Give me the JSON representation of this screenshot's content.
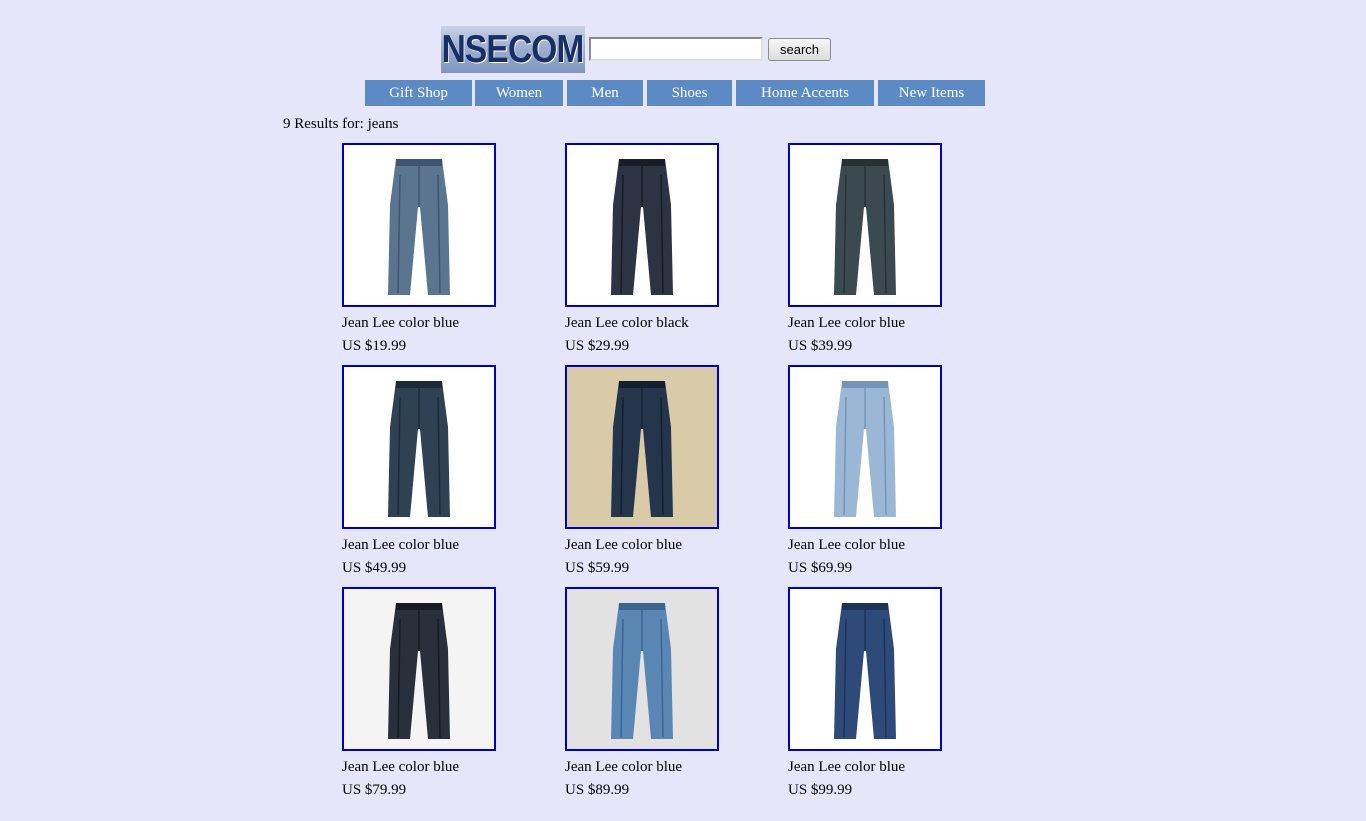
{
  "brand": {
    "logo_text": "NSECOM"
  },
  "search": {
    "value": "",
    "placeholder": "",
    "button_label": "search"
  },
  "nav": {
    "items": [
      {
        "label": "Gift Shop"
      },
      {
        "label": "Women"
      },
      {
        "label": "Men"
      },
      {
        "label": "Shoes"
      },
      {
        "label": "Home Accents"
      },
      {
        "label": "New Items"
      }
    ]
  },
  "results": {
    "heading": "9 Results for: jeans",
    "products": [
      {
        "name": "Jean Lee color blue",
        "price": "US $19.99",
        "image": "blue-jeans-back-icon",
        "bg": "#ffffff",
        "color": "#5b7590",
        "shade": "#3d5570"
      },
      {
        "name": "Jean Lee color black",
        "price": "US $29.99",
        "image": "black-jeans-icon",
        "bg": "#ffffff",
        "color": "#2c3444",
        "shade": "#171c26"
      },
      {
        "name": "Jean Lee color blue",
        "price": "US $39.99",
        "image": "dark-jeans-model-icon",
        "bg": "#ffffff",
        "color": "#3b4a50",
        "shade": "#263135"
      },
      {
        "name": "Jean Lee color blue",
        "price": "US $49.99",
        "image": "dark-jeans-open-fly-icon",
        "bg": "#ffffff",
        "color": "#2f4253",
        "shade": "#1c2a36"
      },
      {
        "name": "Jean Lee color blue",
        "price": "US $59.99",
        "image": "jeans-on-canvas-icon",
        "bg": "#d9cba8",
        "color": "#25364c",
        "shade": "#14202e"
      },
      {
        "name": "Jean Lee color blue",
        "price": "US $69.99",
        "image": "light-cargo-jeans-icon",
        "bg": "#ffffff",
        "color": "#9ab8d6",
        "shade": "#7595b8"
      },
      {
        "name": "Jean Lee color blue",
        "price": "US $79.99",
        "image": "dark-jeans-man-back-icon",
        "bg": "#f4f4f4",
        "color": "#2a2f3c",
        "shade": "#161a22"
      },
      {
        "name": "Jean Lee color blue",
        "price": "US $89.99",
        "image": "flared-blue-jeans-icon",
        "bg": "#e2e2e2",
        "color": "#5a86b4",
        "shade": "#3c6490"
      },
      {
        "name": "Jean Lee color blue",
        "price": "US $99.99",
        "image": "cuffed-capri-jeans-icon",
        "bg": "#ffffff",
        "color": "#2e4a78",
        "shade": "#1d3358"
      }
    ]
  }
}
